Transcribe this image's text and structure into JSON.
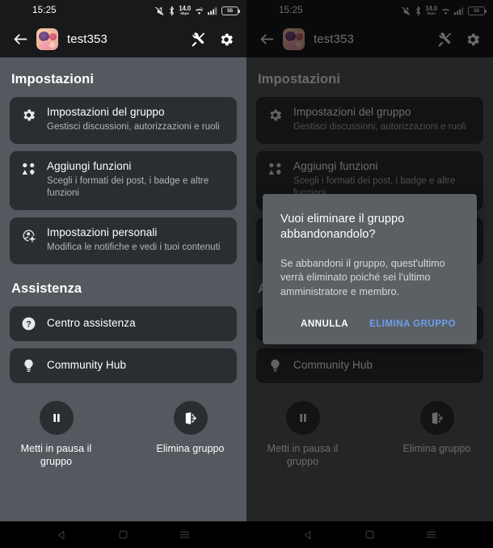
{
  "status_bar": {
    "time": "15:25",
    "icons": [
      "mute-icon",
      "bluetooth-icon",
      "network-speed",
      "wifi-icon",
      "signal-icon",
      "battery-icon"
    ],
    "network_speed_value": "14.0",
    "network_speed_unit": "kbps",
    "battery_level": "55"
  },
  "app_bar": {
    "back_label": "back-arrow",
    "group_name": "test353",
    "tools_icon": "tools-icon",
    "settings_icon": "gear-icon"
  },
  "sections": {
    "settings_heading": "Impostazioni",
    "assistance_heading": "Assistenza"
  },
  "settings_cards": [
    {
      "icon": "gear-icon",
      "title": "Impostazioni del gruppo",
      "subtitle": "Gestisci discussioni, autorizzazioni e ruoli"
    },
    {
      "icon": "people-shapes-icon",
      "title": "Aggiungi funzioni",
      "subtitle": "Scegli i formati dei post, i badge e altre funzioni"
    },
    {
      "icon": "person-gear-icon",
      "title": "Impostazioni personali",
      "subtitle": "Modifica le notifiche e vedi i tuoi contenuti"
    }
  ],
  "assistance_cards": [
    {
      "icon": "question-circle-icon",
      "title": "Centro assistenza"
    },
    {
      "icon": "lightbulb-icon",
      "title": "Community Hub"
    }
  ],
  "bottom_actions": [
    {
      "icon": "pause-icon",
      "label": "Metti in pausa il gruppo"
    },
    {
      "icon": "exit-door-icon",
      "label": "Elimina gruppo"
    }
  ],
  "dialog": {
    "title": "Vuoi eliminare il gruppo abbandonandolo?",
    "body": "Se abbandoni il gruppo, quest'ultimo verrà eliminato poiché sei l'ultimo amministratore e membro.",
    "cancel_label": "ANNULLA",
    "confirm_label": "ELIMINA GRUPPO",
    "confirm_color": "#6d9eeb"
  },
  "nav_bar": {
    "back": "nav-back-icon",
    "home": "nav-home-icon",
    "recents": "nav-recents-icon"
  },
  "colors": {
    "page_background": "#53595e",
    "card_background": "#2b2e31",
    "app_bar_background": "#17191b",
    "dialog_background": "#5b6065",
    "accent": "#6d9eeb"
  }
}
